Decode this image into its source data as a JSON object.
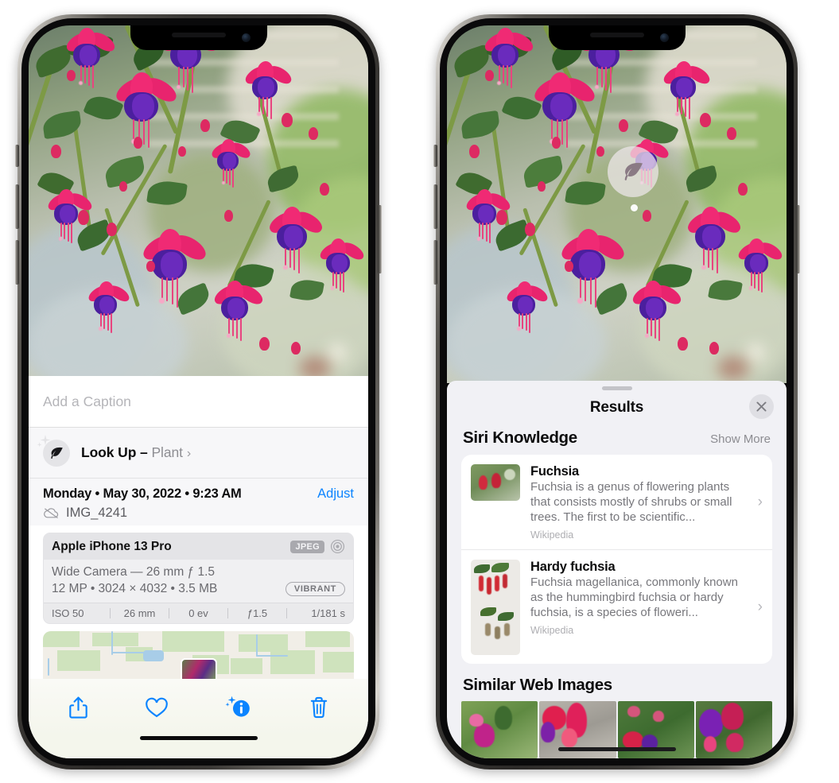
{
  "left_phone": {
    "caption": {
      "placeholder": "Add a Caption",
      "value": ""
    },
    "lookup": {
      "label": "Look Up – ",
      "subject": "Plant",
      "chevron": "›",
      "icon": "leaf-icon"
    },
    "meta": {
      "date": "Monday • May 30, 2022 • 9:23 AM",
      "adjust_label": "Adjust",
      "filename": "IMG_4241",
      "cloud_icon": "icloud-slash-icon"
    },
    "exif": {
      "device": "Apple iPhone 13 Pro",
      "format_badge": "JPEG",
      "lens_icon": "aperture-icon",
      "lens_line": "Wide Camera — 26 mm ƒ 1.5",
      "specs_line": "12 MP • 3024 × 4032 • 3.5 MB",
      "style_badge": "VIBRANT",
      "stats": [
        "ISO 50",
        "26 mm",
        "0 ev",
        "ƒ1.5",
        "1/181 s"
      ]
    },
    "toolbar": [
      {
        "name": "share-button",
        "icon": "share-icon"
      },
      {
        "name": "favorite-button",
        "icon": "heart-icon"
      },
      {
        "name": "info-button",
        "icon": "info-sparkle-icon"
      },
      {
        "name": "delete-button",
        "icon": "trash-icon"
      }
    ]
  },
  "right_phone": {
    "badge": {
      "icon": "leaf-icon"
    },
    "sheet": {
      "title": "Results",
      "close_icon": "close-icon",
      "siri_section": {
        "heading": "Siri Knowledge",
        "show_more": "Show More"
      },
      "results": [
        {
          "title": "Fuchsia",
          "description": "Fuchsia is a genus of flowering plants that consists mostly of shrubs or small trees. The first to be scientific...",
          "source": "Wikipedia",
          "chevron": "›"
        },
        {
          "title": "Hardy fuchsia",
          "description": "Fuchsia magellanica, commonly known as the hummingbird fuchsia or hardy fuchsia, is a species of floweri...",
          "source": "Wikipedia",
          "chevron": "›"
        }
      ],
      "similar_section": {
        "heading": "Similar Web Images",
        "count": 4
      }
    }
  },
  "colors": {
    "accent_blue": "#0b84ff",
    "sheet_bg": "#f1f1f5",
    "card_bg": "#ffffff",
    "secondary_text": "#8e8e93",
    "badge_grey": "#a9a9ae"
  }
}
